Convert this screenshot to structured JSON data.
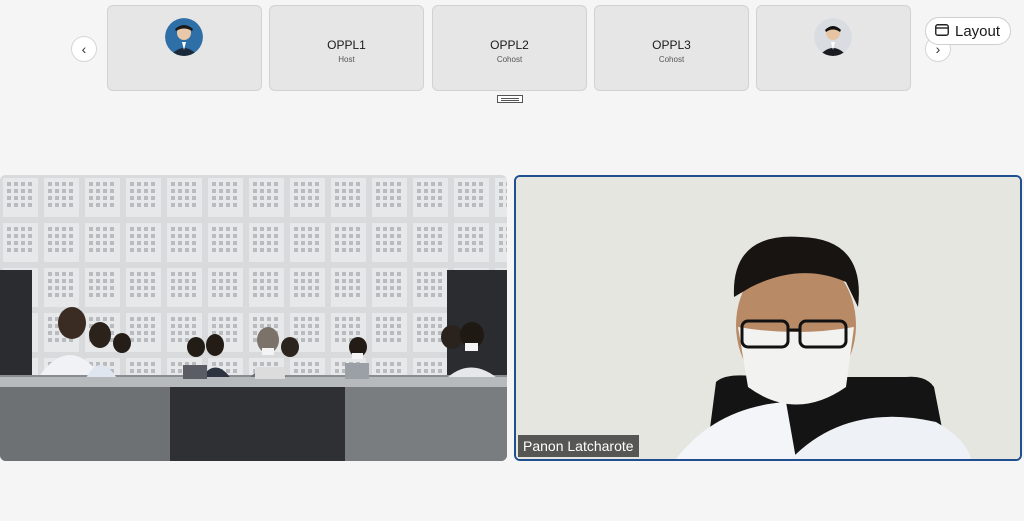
{
  "participant_strip": {
    "tiles": [
      {
        "name": "",
        "role": "",
        "avatar": "avatar-photo"
      },
      {
        "name": "OPPL1",
        "role": "Host"
      },
      {
        "name": "OPPL2",
        "role": "Cohost"
      },
      {
        "name": "OPPL3",
        "role": "Cohost"
      },
      {
        "name": "",
        "role": "",
        "avatar": "avatar-photo"
      }
    ],
    "prev_icon": "chevron-left-icon",
    "next_icon": "chevron-right-icon"
  },
  "layout_button": {
    "label": "Layout",
    "icon": "layout-icon"
  },
  "videos": {
    "left": {
      "description_icon": "conference-room-video"
    },
    "right": {
      "name": "Panon Latcharote"
    }
  },
  "colors": {
    "active_speaker_border": "#1f4f8f",
    "tile_bg": "#e6e6e6",
    "page_bg": "#f5f5f5"
  }
}
